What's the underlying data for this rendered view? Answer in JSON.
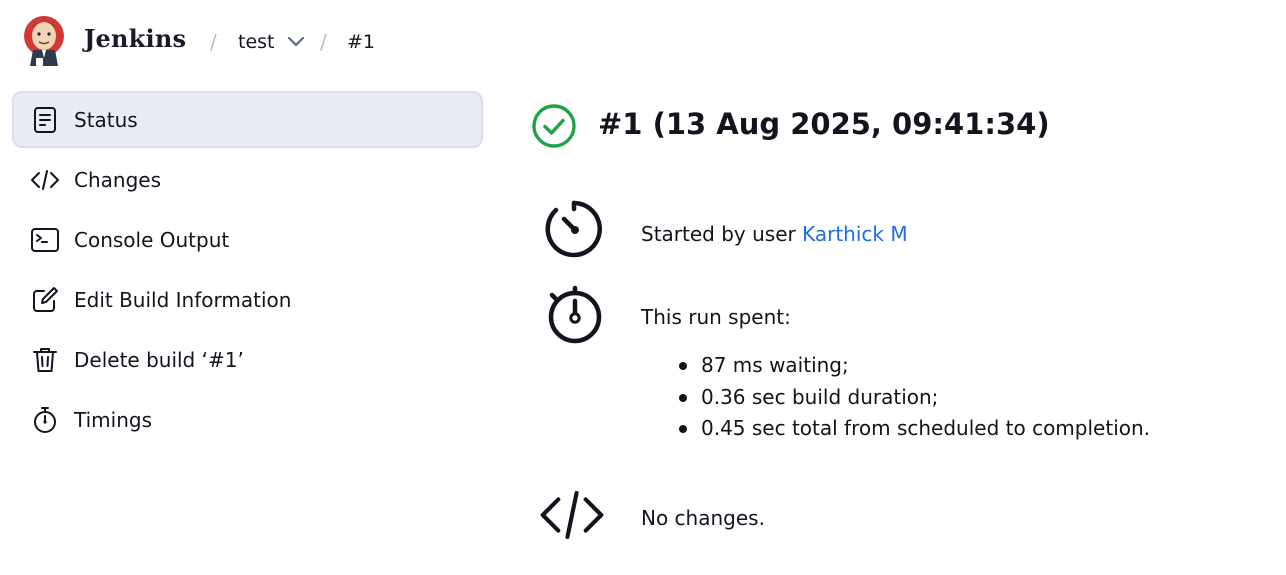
{
  "header": {
    "brand": "Jenkins",
    "breadcrumbs": [
      {
        "label": "test",
        "has_dropdown": true
      },
      {
        "label": "#1",
        "has_dropdown": false
      }
    ],
    "separator": "/"
  },
  "sidebar": {
    "items": [
      {
        "label": "Status",
        "icon": "status-document-icon",
        "active": true
      },
      {
        "label": "Changes",
        "icon": "code-brackets-icon",
        "active": false
      },
      {
        "label": "Console Output",
        "icon": "terminal-icon",
        "active": false
      },
      {
        "label": "Edit Build Information",
        "icon": "edit-icon",
        "active": false
      },
      {
        "label": "Delete build ‘#1’",
        "icon": "trash-icon",
        "active": false
      },
      {
        "label": "Timings",
        "icon": "stopwatch-icon",
        "active": false
      }
    ]
  },
  "main": {
    "title": "#1 (13 Aug 2025, 09:41:34)",
    "status": "success",
    "started_prefix": "Started by user ",
    "started_user": "Karthick M",
    "timing_heading": "This run spent:",
    "timings": [
      "87 ms waiting;",
      "0.36 sec build duration;",
      "0.45 sec total from scheduled to completion."
    ],
    "changes_text": "No changes."
  },
  "colors": {
    "success": "#1ea446",
    "link": "#1e6fdc",
    "active_bg": "#e8ecf5",
    "text": "#14141f"
  }
}
